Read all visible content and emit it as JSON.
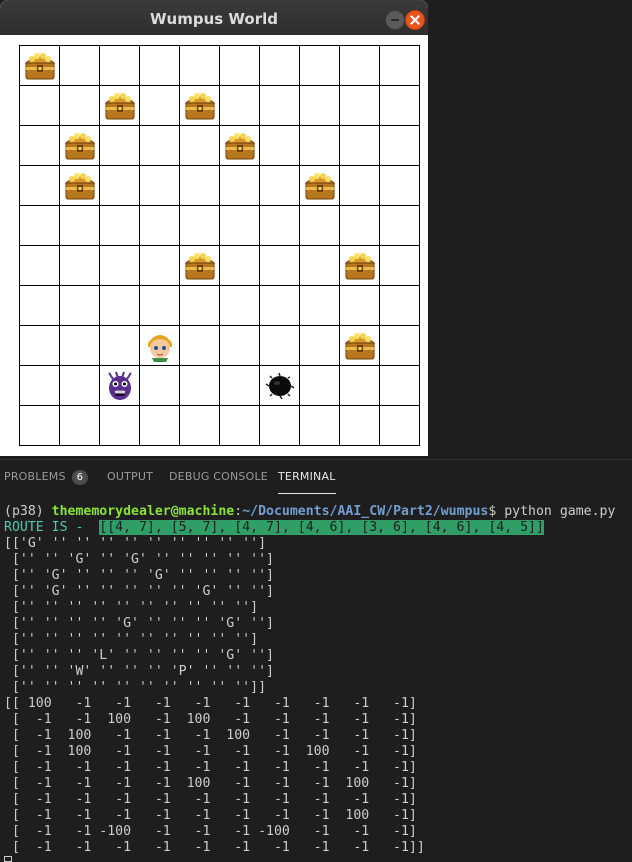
{
  "window": {
    "title": "Wumpus World"
  },
  "board": {
    "cells": [
      [
        "G",
        "",
        "",
        "",
        "",
        "",
        "",
        "",
        "",
        ""
      ],
      [
        "",
        "",
        "G",
        "",
        "G",
        "",
        "",
        "",
        "",
        ""
      ],
      [
        "",
        "G",
        "",
        "",
        "",
        "G",
        "",
        "",
        "",
        ""
      ],
      [
        "",
        "G",
        "",
        "",
        "",
        "",
        "",
        "G",
        "",
        ""
      ],
      [
        "",
        "",
        "",
        "",
        "",
        "",
        "",
        "",
        "",
        ""
      ],
      [
        "",
        "",
        "",
        "",
        "G",
        "",
        "",
        "",
        "G",
        ""
      ],
      [
        "",
        "",
        "",
        "",
        "",
        "",
        "",
        "",
        "",
        ""
      ],
      [
        "",
        "",
        "",
        "L",
        "",
        "",
        "",
        "",
        "G",
        ""
      ],
      [
        "",
        "",
        "W",
        "",
        "",
        "",
        "P",
        "",
        "",
        ""
      ],
      [
        "",
        "",
        "",
        "",
        "",
        "",
        "",
        "",
        "",
        ""
      ]
    ],
    "icons": {
      "G": "treasure-chest-icon",
      "L": "player-icon",
      "W": "wumpus-icon",
      "P": "pit-icon"
    }
  },
  "panel": {
    "tabs": [
      {
        "label": "PROBLEMS",
        "badge": "6"
      },
      {
        "label": "OUTPUT"
      },
      {
        "label": "DEBUG CONSOLE"
      },
      {
        "label": "TERMINAL",
        "active": true
      }
    ]
  },
  "terminal": {
    "env": "(p38) ",
    "user": "thememorydealer@machine",
    "colon": ":",
    "path": "~/Documents/AAI_CW/Part2/wumpus",
    "command": "$ python game.py",
    "route_label": "ROUTE IS -  ",
    "route_value": "[[4, 7], [5, 7], [4, 7], [4, 6], [3, 6], [4, 6], [4, 5]]",
    "lines": [
      "[['G' '' '' '' '' '' '' '' '' '']",
      " ['' '' 'G' '' 'G' '' '' '' '' '']",
      " ['' 'G' '' '' '' 'G' '' '' '' '']",
      " ['' 'G' '' '' '' '' '' 'G' '' '']",
      " ['' '' '' '' '' '' '' '' '' '']",
      " ['' '' '' '' 'G' '' '' '' 'G' '']",
      " ['' '' '' '' '' '' '' '' '' '']",
      " ['' '' '' 'L' '' '' '' '' 'G' '']",
      " ['' '' 'W' '' '' '' 'P' '' '' '']",
      " ['' '' '' '' '' '' '' '' '' '']]",
      "[[ 100   -1   -1   -1   -1   -1   -1   -1   -1   -1]",
      " [  -1   -1  100   -1  100   -1   -1   -1   -1   -1]",
      " [  -1  100   -1   -1   -1  100   -1   -1   -1   -1]",
      " [  -1  100   -1   -1   -1   -1   -1  100   -1   -1]",
      " [  -1   -1   -1   -1   -1   -1   -1   -1   -1   -1]",
      " [  -1   -1   -1   -1  100   -1   -1   -1  100   -1]",
      " [  -1   -1   -1   -1   -1   -1   -1   -1   -1   -1]",
      " [  -1   -1   -1   -1   -1   -1   -1   -1  100   -1]",
      " [  -1   -1 -100   -1   -1   -1 -100   -1   -1   -1]",
      " [  -1   -1   -1   -1   -1   -1   -1   -1   -1   -1]]"
    ]
  }
}
